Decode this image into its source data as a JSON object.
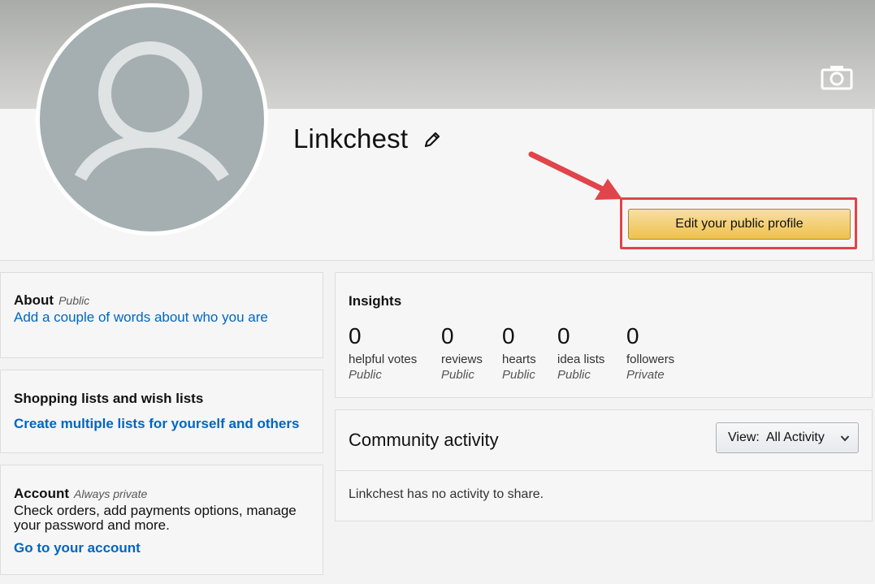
{
  "profile": {
    "name": "Linkchest",
    "edit_button_label": "Edit your public profile"
  },
  "icons": {
    "banner_camera": "camera-icon",
    "avatar_camera": "camera-icon",
    "edit_name": "pencil-icon",
    "dropdown": "chevron-down-icon"
  },
  "about": {
    "title": "About",
    "visibility": "Public",
    "link": "Add a couple of words about who you are"
  },
  "shopping": {
    "title": "Shopping lists and wish lists",
    "link": "Create multiple lists for yourself and others"
  },
  "account": {
    "title": "Account",
    "visibility": "Always private",
    "description_line1": "Check orders, add payments options, manage",
    "description_line2": "your password and more.",
    "link": "Go to your account"
  },
  "insights": {
    "title": "Insights",
    "stats": [
      {
        "value": "0",
        "label": "helpful votes",
        "visibility": "Public"
      },
      {
        "value": "0",
        "label": "reviews",
        "visibility": "Public"
      },
      {
        "value": "0",
        "label": "hearts",
        "visibility": "Public"
      },
      {
        "value": "0",
        "label": "idea lists",
        "visibility": "Public"
      },
      {
        "value": "0",
        "label": "followers",
        "visibility": "Private"
      }
    ]
  },
  "community": {
    "title": "Community activity",
    "view_label": "View:",
    "view_value": "All Activity",
    "empty_message": "Linkchest has no activity to share."
  },
  "colors": {
    "accent_button": "#f0c14b",
    "link": "#0066c0",
    "highlight": "#e1444a"
  }
}
